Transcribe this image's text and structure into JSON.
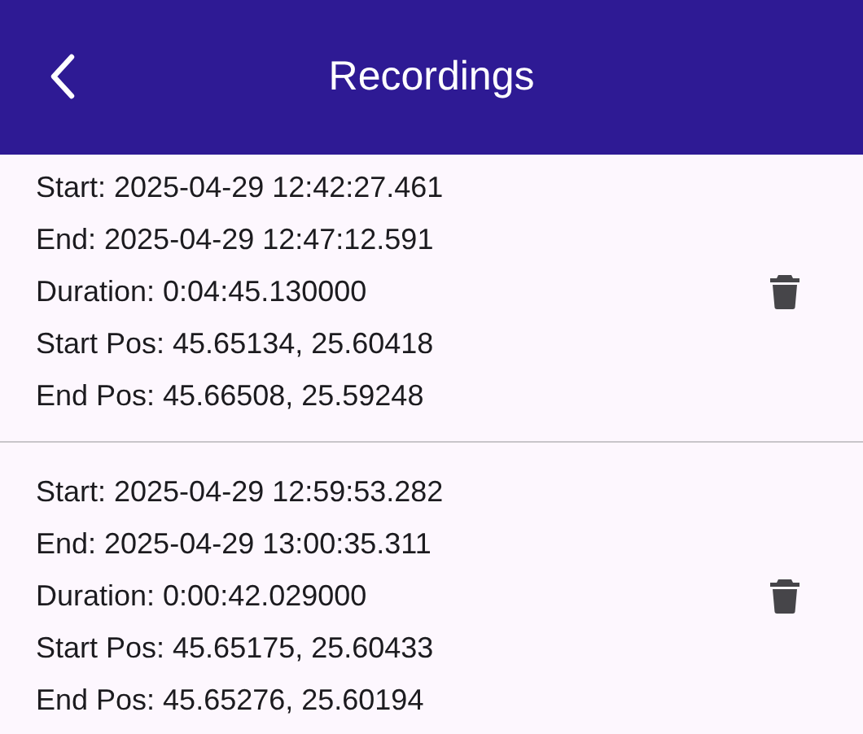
{
  "app_bar": {
    "title": "Recordings"
  },
  "recordings": [
    {
      "start": "Start: 2025-04-29 12:42:27.461",
      "end": "End: 2025-04-29 12:47:12.591",
      "duration": "Duration: 0:04:45.130000",
      "start_pos": "Start Pos: 45.65134, 25.60418",
      "end_pos": "End Pos: 45.66508, 25.59248"
    },
    {
      "start": "Start: 2025-04-29 12:59:53.282",
      "end": "End: 2025-04-29 13:00:35.311",
      "duration": "Duration: 0:00:42.029000",
      "start_pos": "Start Pos: 45.65175, 25.60433",
      "end_pos": "End Pos: 45.65276, 25.60194"
    }
  ]
}
